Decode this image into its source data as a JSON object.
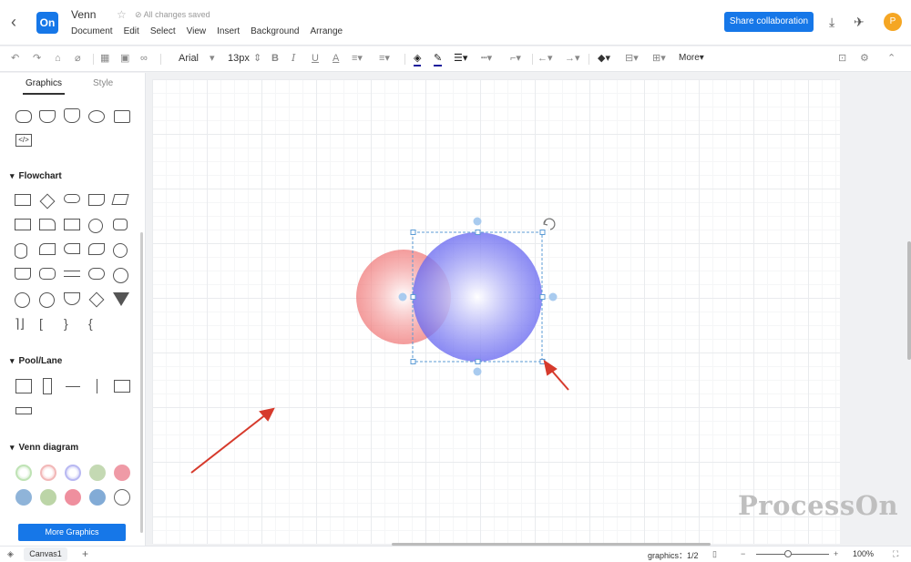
{
  "header": {
    "title": "Venn",
    "saved_status": "All changes saved",
    "logo_text": "On",
    "menus": [
      "Document",
      "Edit",
      "Select",
      "View",
      "Insert",
      "Background",
      "Arrange"
    ],
    "share_label": "Share collaboration",
    "avatar_initial": "P"
  },
  "toolbar": {
    "font": "Arial",
    "font_size": "13px",
    "more_label": "More"
  },
  "sidebar": {
    "tabs": [
      "Graphics",
      "Style"
    ],
    "sections": {
      "flowchart": "Flowchart",
      "pool": "Pool/Lane",
      "venn": "Venn diagram"
    },
    "more_button": "More Graphics"
  },
  "canvas": {
    "selection_color": "#5b9bd5",
    "circle_red": "#ef6f6f",
    "circle_blue": "#6b6bf0"
  },
  "status": {
    "canvas_tab": "Canvas1",
    "graphics_label": "graphics：",
    "graphics_count": "1/2",
    "zoom": "100%"
  },
  "watermark": "ProcessOn"
}
